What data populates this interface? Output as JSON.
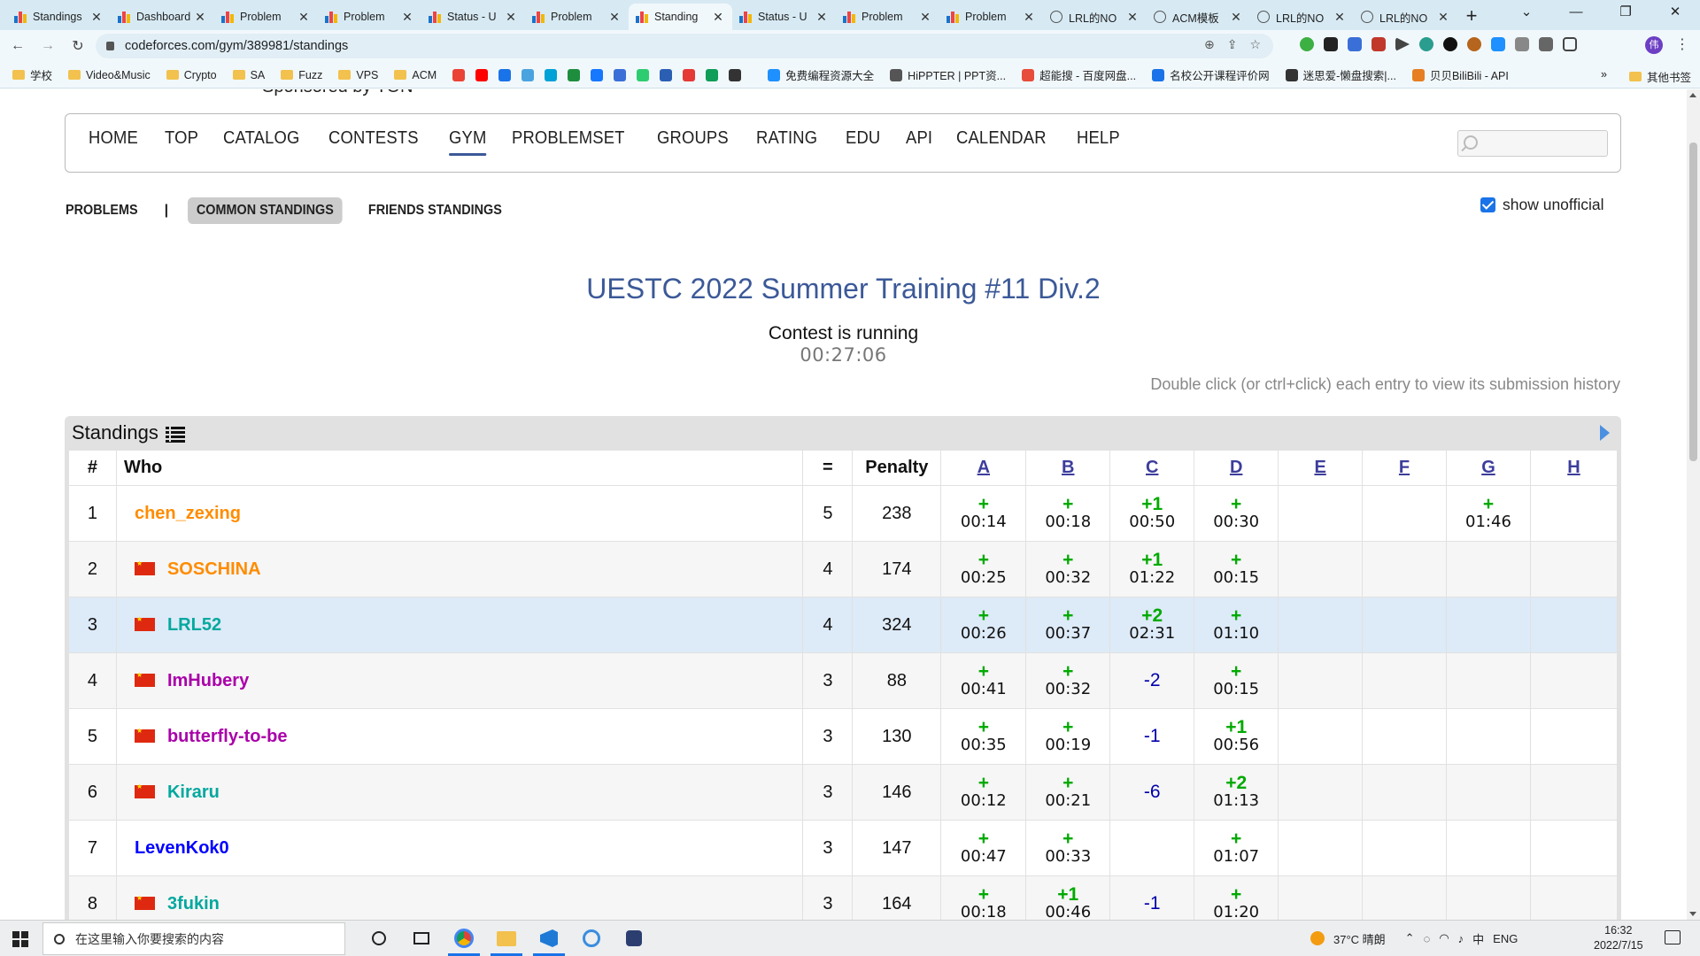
{
  "browser": {
    "tabs": [
      {
        "title": "Standings",
        "fav": "cf",
        "active": false
      },
      {
        "title": "Dashboard",
        "fav": "cf",
        "active": false
      },
      {
        "title": "Problem",
        "fav": "cf",
        "active": false
      },
      {
        "title": "Problem",
        "fav": "cf",
        "active": false
      },
      {
        "title": "Status - U",
        "fav": "cf",
        "active": false
      },
      {
        "title": "Problem",
        "fav": "cf",
        "active": false
      },
      {
        "title": "Standing",
        "fav": "cf",
        "active": true
      },
      {
        "title": "Status - U",
        "fav": "cf",
        "active": false
      },
      {
        "title": "Problem",
        "fav": "cf",
        "active": false
      },
      {
        "title": "Problem",
        "fav": "cf",
        "active": false
      },
      {
        "title": "LRL的NO",
        "fav": "globe",
        "active": false
      },
      {
        "title": "ACM模板",
        "fav": "globe",
        "active": false
      },
      {
        "title": "LRL的NO",
        "fav": "globe",
        "active": false
      },
      {
        "title": "LRL的NO",
        "fav": "globe",
        "active": false
      }
    ],
    "url": "codeforces.com/gym/389981/standings",
    "profile_initial": "伟",
    "bookmarks": [
      {
        "label": "学校",
        "type": "folder"
      },
      {
        "label": "Video&Music",
        "type": "folder"
      },
      {
        "label": "Crypto",
        "type": "folder"
      },
      {
        "label": "SA",
        "type": "folder"
      },
      {
        "label": "Fuzz",
        "type": "folder"
      },
      {
        "label": "VPS",
        "type": "folder"
      },
      {
        "label": "ACM",
        "type": "folder"
      },
      {
        "label": "免费编程资源大全",
        "type": "site"
      },
      {
        "label": "HiPPTER | PPT资...",
        "type": "site"
      },
      {
        "label": "超能搜 - 百度网盘...",
        "type": "site"
      },
      {
        "label": "名校公开课程评价网",
        "type": "site"
      },
      {
        "label": "迷思爱-懒盘搜索|...",
        "type": "site"
      },
      {
        "label": "贝贝BiliBili - API",
        "type": "site"
      }
    ],
    "other_bookmarks": "其他书签",
    "more_bookmarks": "»"
  },
  "site": {
    "sponsor": "Sponsored by TON",
    "menu": [
      {
        "label": "HOME",
        "active": false
      },
      {
        "label": "TOP",
        "active": false
      },
      {
        "label": "CATALOG",
        "active": false
      },
      {
        "label": "CONTESTS",
        "active": false
      },
      {
        "label": "GYM",
        "active": true
      },
      {
        "label": "PROBLEMSET",
        "active": false
      },
      {
        "label": "GROUPS",
        "active": false
      },
      {
        "label": "RATING",
        "active": false
      },
      {
        "label": "EDU",
        "active": false
      },
      {
        "label": "API",
        "active": false
      },
      {
        "label": "CALENDAR",
        "active": false
      },
      {
        "label": "HELP",
        "active": false
      }
    ],
    "second_menu": {
      "problems": "PROBLEMS",
      "separator": "|",
      "common": "COMMON STANDINGS",
      "friends": "FRIENDS STANDINGS"
    },
    "show_unofficial": "show unofficial"
  },
  "contest": {
    "title": "UESTC 2022 Summer Training #11 Div.2",
    "status": "Contest is running",
    "timer": "00:27:06",
    "hint": "Double click (or ctrl+click) each entry to view its submission history"
  },
  "standings": {
    "heading": "Standings",
    "columns": {
      "rank": "#",
      "who": "Who",
      "solved": "=",
      "penalty": "Penalty"
    },
    "problems": [
      "A",
      "B",
      "C",
      "D",
      "E",
      "F",
      "G",
      "H"
    ],
    "rows": [
      {
        "rank": "1",
        "flag": false,
        "handle": "chen_zexing",
        "color": "#ff8c00",
        "solved": "5",
        "penalty": "238",
        "cells": [
          {
            "acc": "+",
            "time": "00:14"
          },
          {
            "acc": "+",
            "time": "00:18"
          },
          {
            "acc": "+1",
            "time": "00:50"
          },
          {
            "acc": "+",
            "time": "00:30"
          },
          null,
          null,
          {
            "acc": "+",
            "time": "01:46"
          },
          null
        ]
      },
      {
        "rank": "2",
        "flag": true,
        "handle": "SOSCHINA",
        "color": "#ff8c00",
        "solved": "4",
        "penalty": "174",
        "cells": [
          {
            "acc": "+",
            "time": "00:25"
          },
          {
            "acc": "+",
            "time": "00:32"
          },
          {
            "acc": "+1",
            "time": "01:22"
          },
          {
            "acc": "+",
            "time": "00:15"
          },
          null,
          null,
          null,
          null
        ]
      },
      {
        "rank": "3",
        "flag": true,
        "handle": "LRL52",
        "color": "#03a89e",
        "solved": "4",
        "penalty": "324",
        "cells": [
          {
            "acc": "+",
            "time": "00:26"
          },
          {
            "acc": "+",
            "time": "00:37"
          },
          {
            "acc": "+2",
            "time": "02:31"
          },
          {
            "acc": "+",
            "time": "01:10"
          },
          null,
          null,
          null,
          null
        ]
      },
      {
        "rank": "4",
        "flag": true,
        "handle": "ImHubery",
        "color": "#aa00aa",
        "solved": "3",
        "penalty": "88",
        "cells": [
          {
            "acc": "+",
            "time": "00:41"
          },
          {
            "acc": "+",
            "time": "00:32"
          },
          {
            "rej": "-2"
          },
          {
            "acc": "+",
            "time": "00:15"
          },
          null,
          null,
          null,
          null
        ]
      },
      {
        "rank": "5",
        "flag": true,
        "handle": "butterfly-to-be",
        "color": "#aa00aa",
        "solved": "3",
        "penalty": "130",
        "cells": [
          {
            "acc": "+",
            "time": "00:35"
          },
          {
            "acc": "+",
            "time": "00:19"
          },
          {
            "rej": "-1"
          },
          {
            "acc": "+1",
            "time": "00:56"
          },
          null,
          null,
          null,
          null
        ]
      },
      {
        "rank": "6",
        "flag": true,
        "handle": "Kiraru",
        "color": "#03a89e",
        "solved": "3",
        "penalty": "146",
        "cells": [
          {
            "acc": "+",
            "time": "00:12"
          },
          {
            "acc": "+",
            "time": "00:21"
          },
          {
            "rej": "-6"
          },
          {
            "acc": "+2",
            "time": "01:13"
          },
          null,
          null,
          null,
          null
        ]
      },
      {
        "rank": "7",
        "flag": false,
        "handle": "LevenKok0",
        "color": "#0000ff",
        "solved": "3",
        "penalty": "147",
        "cells": [
          {
            "acc": "+",
            "time": "00:47"
          },
          {
            "acc": "+",
            "time": "00:33"
          },
          null,
          {
            "acc": "+",
            "time": "01:07"
          },
          null,
          null,
          null,
          null
        ]
      },
      {
        "rank": "8",
        "flag": true,
        "handle": "3fukin",
        "color": "#03a89e",
        "solved": "3",
        "penalty": "164",
        "cells": [
          {
            "acc": "+",
            "time": "00:18"
          },
          {
            "acc": "+1",
            "time": "00:46"
          },
          {
            "rej": "-1"
          },
          {
            "acc": "+",
            "time": "01:20"
          },
          null,
          null,
          null,
          null
        ]
      }
    ]
  },
  "taskbar": {
    "search_placeholder": "在这里输入你要搜索的内容",
    "weather": "37°C 晴朗",
    "lang": "ENG",
    "input_mode": "中",
    "time": "16:32",
    "date": "2022/7/15"
  }
}
